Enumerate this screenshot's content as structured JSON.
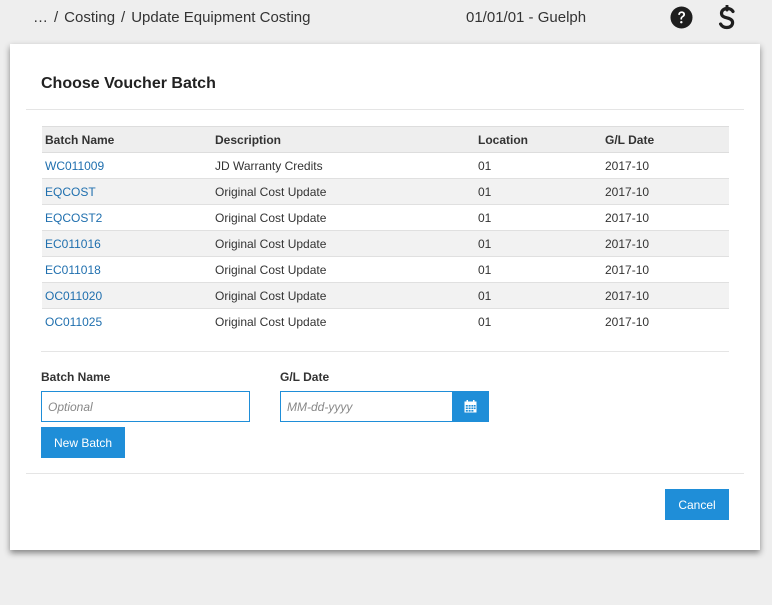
{
  "header": {
    "breadcrumb": [
      "…",
      "Costing",
      "Update Equipment Costing"
    ],
    "separator": "/",
    "context": "01/01/01 - Guelph",
    "help_icon": "question-circle-icon",
    "brand_icon": "s-logo-icon"
  },
  "modal": {
    "title": "Choose Voucher Batch",
    "table": {
      "columns": [
        "Batch Name",
        "Description",
        "Location",
        "G/L Date"
      ],
      "rows": [
        {
          "batch": "WC011009",
          "description": "JD Warranty Credits",
          "location": "01",
          "gl_date": "2017-10"
        },
        {
          "batch": "EQCOST",
          "description": "Original Cost Update",
          "location": "01",
          "gl_date": "2017-10"
        },
        {
          "batch": "EQCOST2",
          "description": "Original Cost Update",
          "location": "01",
          "gl_date": "2017-10"
        },
        {
          "batch": "EC011016",
          "description": "Original Cost Update",
          "location": "01",
          "gl_date": "2017-10"
        },
        {
          "batch": "EC011018",
          "description": "Original Cost Update",
          "location": "01",
          "gl_date": "2017-10"
        },
        {
          "batch": "OC011020",
          "description": "Original Cost Update",
          "location": "01",
          "gl_date": "2017-10"
        },
        {
          "batch": "OC011025",
          "description": "Original Cost Update",
          "location": "01",
          "gl_date": "2017-10"
        }
      ]
    },
    "form": {
      "batch_name_label": "Batch Name",
      "batch_name_placeholder": "Optional",
      "batch_name_value": "",
      "gl_date_label": "G/L Date",
      "gl_date_placeholder": "MM-dd-yyyy",
      "gl_date_value": "",
      "calendar_icon": "calendar-icon",
      "new_batch_label": "New Batch"
    },
    "cancel_label": "Cancel"
  },
  "colors": {
    "accent": "#1f8ed8",
    "link": "#1f6fae",
    "background": "#eeeeee"
  }
}
